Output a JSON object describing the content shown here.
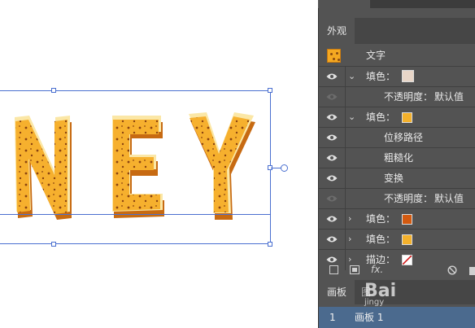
{
  "canvas": {
    "letters": [
      "N",
      "E",
      "Y"
    ]
  },
  "panel": {
    "title": "外观",
    "object_label": "文字",
    "rows": [
      {
        "label": "填色：",
        "swatch": "#e8d6c8",
        "chevron": "⌄",
        "eye": true
      },
      {
        "label": "不透明度：",
        "value": "默认值",
        "eye": false
      },
      {
        "label": "填色：",
        "swatch": "#f4b12c",
        "chevron": "⌄",
        "eye": true
      },
      {
        "label": "位移路径",
        "eye": true
      },
      {
        "label": "粗糙化",
        "eye": true
      },
      {
        "label": "变换",
        "eye": true
      },
      {
        "label": "不透明度：",
        "value": "默认值",
        "eye": false
      },
      {
        "label": "填色：",
        "swatch": "#d35a10",
        "chevron": "›",
        "eye": true
      },
      {
        "label": "填色：",
        "swatch": "#f4b12c",
        "chevron": "›",
        "eye": true
      },
      {
        "label": "描边：",
        "swatch": "none",
        "chevron": "›",
        "eye": true
      }
    ],
    "footer_icons": [
      "new-stroke-icon",
      "new-fill-icon",
      "fx-icon",
      "clear-icon",
      "delete-icon"
    ],
    "fx_label": "fx."
  },
  "artboards": {
    "tab": "画板",
    "tab2": "图",
    "rows": [
      {
        "index": "1",
        "name": "画板 1"
      }
    ]
  },
  "watermark": {
    "text": "Bai",
    "sub": "jingy"
  }
}
